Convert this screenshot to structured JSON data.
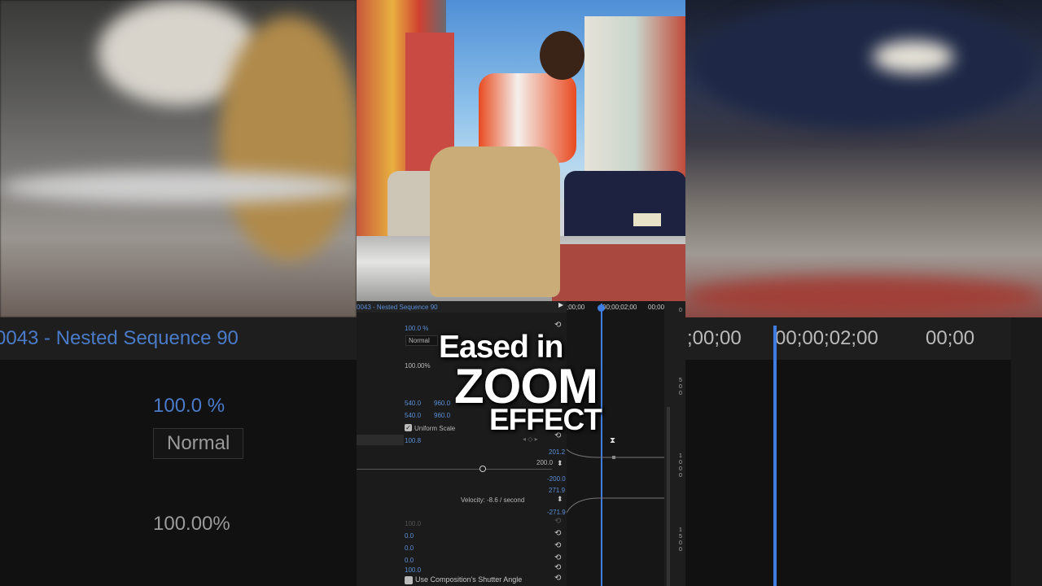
{
  "sequence_title": "0043 - Nested Sequence 90",
  "timecodes": {
    "t0": ";00;00",
    "t1": "00;00;02;00",
    "t2": "00;00"
  },
  "properties": {
    "opacity": "100.0 %",
    "blend_mode": "Normal",
    "time_remap": "100.00%",
    "position": [
      "540.0",
      "960.0"
    ],
    "anchor": [
      "540.0",
      "960.0"
    ],
    "uniform_scale": "Uniform Scale",
    "scale": "100.8",
    "graph_max": "201.2",
    "graph_value": "200.0",
    "graph_min": "-200.0",
    "velocity_max": "271.9",
    "velocity_label": "Velocity: -8.6 / second",
    "velocity_min": "-271.9",
    "disabled_value": "100.0",
    "rotation": "0.0",
    "val2": "0.0",
    "val3": "0.0",
    "val4": "100.0",
    "shutter": "Use Composition's Shutter Angle"
  },
  "ruler_marks": [
    "0",
    "500",
    "1000",
    "1500"
  ],
  "overlay": {
    "line1": "Eased in",
    "line2": "ZOOM",
    "line3": "EFFECT"
  },
  "colors": {
    "accent": "#5b8fd8",
    "playhead": "#3f7de0"
  }
}
